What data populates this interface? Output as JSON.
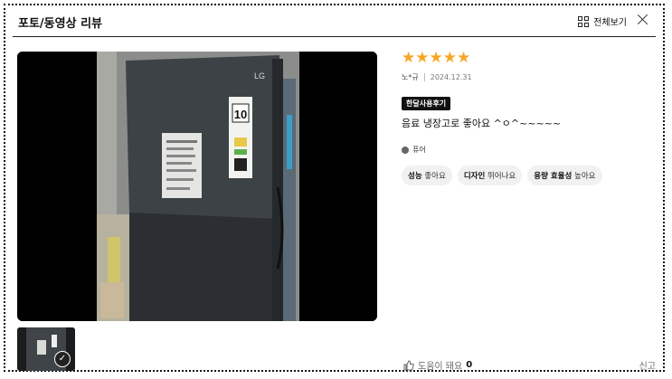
{
  "header": {
    "title": "포토/동영상 리뷰",
    "view_all_label": "전체보기"
  },
  "review": {
    "rating": 5,
    "stars": "★★★★★",
    "author": "노*규",
    "date": "2024.12.31",
    "badge": "한달사용후기",
    "text": "음료 냉장고로 좋아요 ^ㅇ^~~~~~",
    "option": "퓨어",
    "tags": [
      {
        "key": "성능",
        "value": "좋아요"
      },
      {
        "key": "디자인",
        "value": "뛰어나요"
      },
      {
        "key": "용량 효율성",
        "value": "높아요"
      }
    ],
    "helpful_label": "도움이 돼요",
    "helpful_count": "0",
    "report_label": "신고"
  },
  "photo": {
    "brand_text": "LG",
    "energy_grade": "10"
  },
  "colors": {
    "star": "#f5a623",
    "badge_bg": "#111111",
    "tag_bg": "#f1f1f1"
  }
}
